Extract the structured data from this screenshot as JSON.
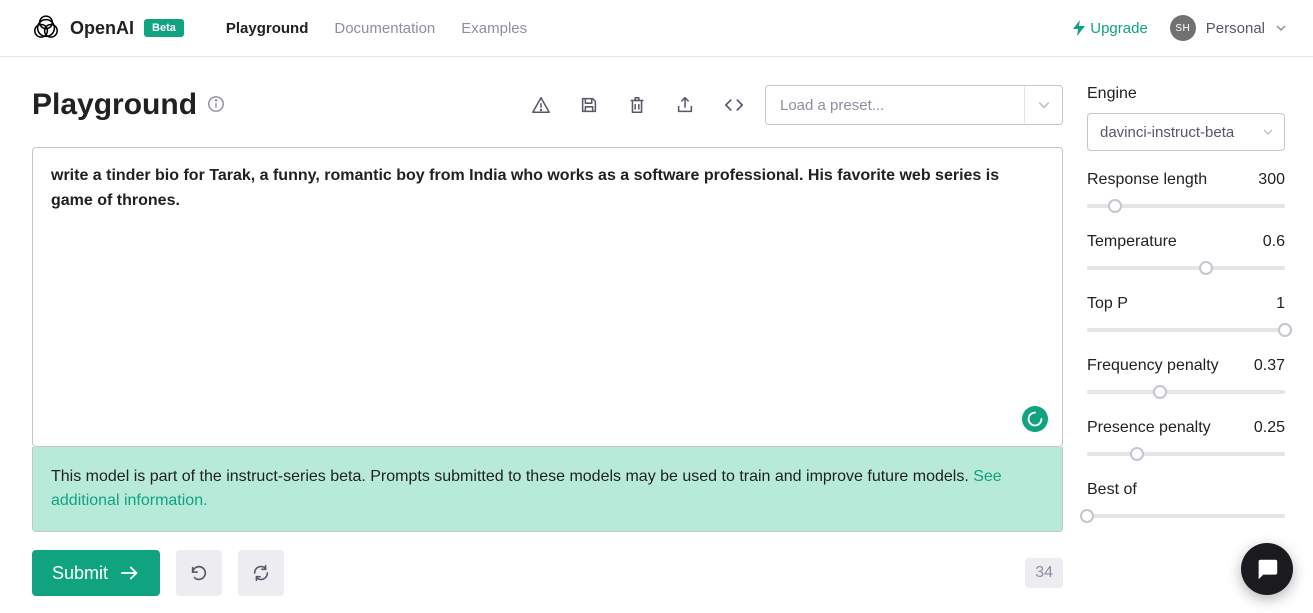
{
  "header": {
    "brand": "OpenAI",
    "beta_badge": "Beta",
    "nav": [
      {
        "label": "Playground",
        "active": true
      },
      {
        "label": "Documentation",
        "active": false
      },
      {
        "label": "Examples",
        "active": false
      }
    ],
    "upgrade_label": "Upgrade",
    "account": {
      "avatar_initials": "SH",
      "label": "Personal"
    }
  },
  "title": "Playground",
  "toolbar_icons": [
    "warning",
    "save",
    "delete",
    "share",
    "code"
  ],
  "preset_placeholder": "Load a preset...",
  "editor": {
    "content": "write a tinder bio for Tarak, a funny, romantic boy from India who works as a software professional. His favorite web series is game of thrones.",
    "loading": true
  },
  "notice": {
    "text": "This model is part of the instruct-series beta. Prompts submitted to these models may be used to train and improve future models. ",
    "link_text": "See additional information."
  },
  "actions": {
    "submit_label": "Submit",
    "token_count": "34"
  },
  "sidebar": {
    "engine": {
      "label": "Engine",
      "value": "davinci-instruct-beta"
    },
    "sliders": [
      {
        "key": "response_length",
        "label": "Response length",
        "value": "300",
        "pct": 14
      },
      {
        "key": "temperature",
        "label": "Temperature",
        "value": "0.6",
        "pct": 60
      },
      {
        "key": "top_p",
        "label": "Top P",
        "value": "1",
        "pct": 100
      },
      {
        "key": "frequency_penalty",
        "label": "Frequency penalty",
        "value": "0.37",
        "pct": 37
      },
      {
        "key": "presence_penalty",
        "label": "Presence penalty",
        "value": "0.25",
        "pct": 25
      },
      {
        "key": "best_of",
        "label": "Best of",
        "value": "",
        "pct": 0
      }
    ]
  },
  "colors": {
    "accent": "#10a37f"
  }
}
